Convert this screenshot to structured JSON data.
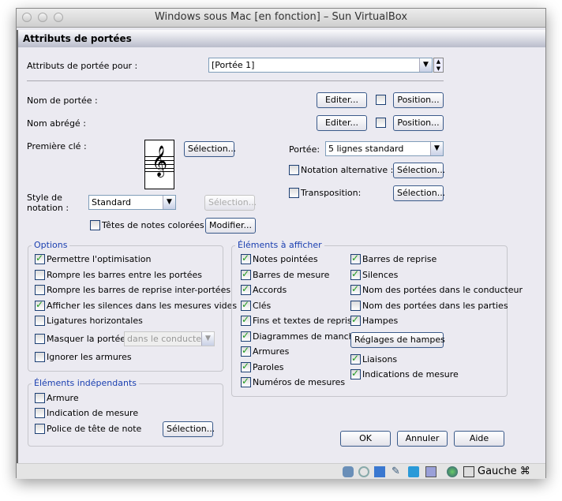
{
  "window": {
    "title": "Windows sous Mac [en fonction] – Sun VirtualBox"
  },
  "dialog": {
    "title": "Attributs de portées"
  },
  "staff_for": {
    "label": "Attributs de portée pour :",
    "value": "[Portée 1]"
  },
  "staff_name": {
    "label": "Nom de portée :",
    "edit": "Editer...",
    "position": "Position...",
    "checked": false
  },
  "short_name": {
    "label": "Nom abrégé :",
    "edit": "Editer...",
    "position": "Position...",
    "checked": false
  },
  "first_clef": {
    "label": "Première clé :",
    "select": "Sélection..."
  },
  "staff_type": {
    "label": "Portée:",
    "value": "5 lignes standard"
  },
  "alt_notation": {
    "label": "Notation alternative :",
    "select": "Sélection...",
    "checked": false
  },
  "transposition": {
    "label": "Transposition:",
    "select": "Sélection...",
    "checked": false
  },
  "notation_style": {
    "label1": "Style de",
    "label2": "notation :",
    "value": "Standard",
    "select": "Sélection..."
  },
  "colored_noteheads": {
    "label": "Têtes de notes colorées",
    "modify": "Modifier...",
    "checked": false
  },
  "options": {
    "title": "Options",
    "items": [
      {
        "label": "Permettre l'optimisation",
        "checked": true
      },
      {
        "label": "Rompre les barres entre les portées",
        "checked": false
      },
      {
        "label": "Rompre les barres de reprise inter-portées",
        "checked": false
      },
      {
        "label": "Afficher les silences dans les mesures vides",
        "checked": true
      },
      {
        "label": "Ligatures horizontales",
        "checked": false
      },
      {
        "label": "Masquer la portée",
        "checked": false
      },
      {
        "label": "Ignorer les armures",
        "checked": false
      }
    ],
    "hide_mode": "dans le conducteur"
  },
  "independent": {
    "title": "Éléments indépendants",
    "items": [
      {
        "label": "Armure",
        "checked": false
      },
      {
        "label": "Indication de mesure",
        "checked": false
      },
      {
        "label": "Police de tête de note",
        "checked": false
      }
    ],
    "select": "Sélection..."
  },
  "display": {
    "title": "Éléments à afficher",
    "left": [
      {
        "label": "Notes pointées",
        "checked": true
      },
      {
        "label": "Barres de mesure",
        "checked": true
      },
      {
        "label": "Accords",
        "checked": true
      },
      {
        "label": "Clés",
        "checked": true
      },
      {
        "label": "Fins et textes de reprise",
        "checked": true
      },
      {
        "label": "Diagrammes de manche",
        "checked": true
      },
      {
        "label": "Armures",
        "checked": true
      },
      {
        "label": "Paroles",
        "checked": true
      },
      {
        "label": "Numéros de mesures",
        "checked": true
      }
    ],
    "right": [
      {
        "label": "Barres de reprise",
        "checked": true
      },
      {
        "label": "Silences",
        "checked": true
      },
      {
        "label": "Nom des portées dans le conducteur",
        "checked": true
      },
      {
        "label": "Nom des portées dans les parties",
        "checked": false
      },
      {
        "label": "Hampes",
        "checked": true
      },
      {
        "label": "Liaisons",
        "checked": true
      },
      {
        "label": "Indications de mesure",
        "checked": true
      }
    ],
    "stem_settings": "Réglages de hampes"
  },
  "footer": {
    "ok": "OK",
    "cancel": "Annuler",
    "help": "Aide"
  },
  "statusbar": {
    "host_key": "Gauche ⌘"
  }
}
